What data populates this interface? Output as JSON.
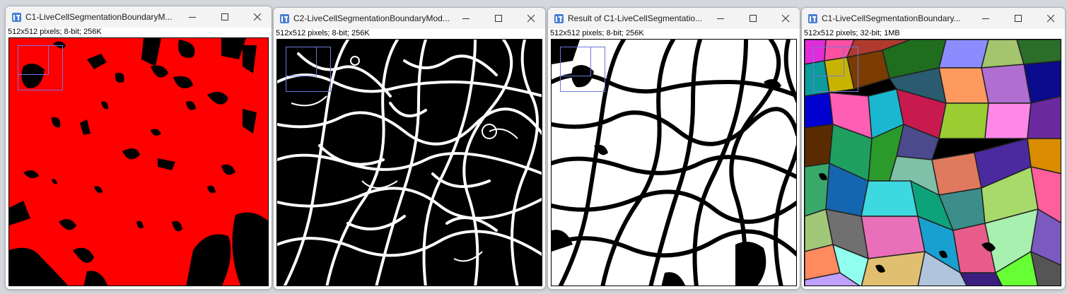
{
  "windows": [
    {
      "title": "C1-LiveCellSegmentationBoundaryM...",
      "info": "512x512 pixels; 8-bit; 256K",
      "style": "mask-red"
    },
    {
      "title": "C2-LiveCellSegmentationBoundaryMod...",
      "info": "512x512 pixels; 8-bit; 256K",
      "style": "boundary"
    },
    {
      "title": "Result of C1-LiveCellSegmentatio...",
      "info": "512x512 pixels; 8-bit; 256K",
      "style": "binary"
    },
    {
      "title": "C1-LiveCellSegmentationBoundary...",
      "info": "512x512 pixels; 32-bit; 1MB",
      "style": "labels"
    }
  ],
  "colors": {
    "mask_red": "#ff0000",
    "roi_outline": "#6f77d8",
    "icon_blue": "#4a7fd4"
  },
  "icons": {
    "app": "imagej-window-icon",
    "minimize": "minimize-icon",
    "maximize": "maximize-icon",
    "close": "close-icon"
  }
}
